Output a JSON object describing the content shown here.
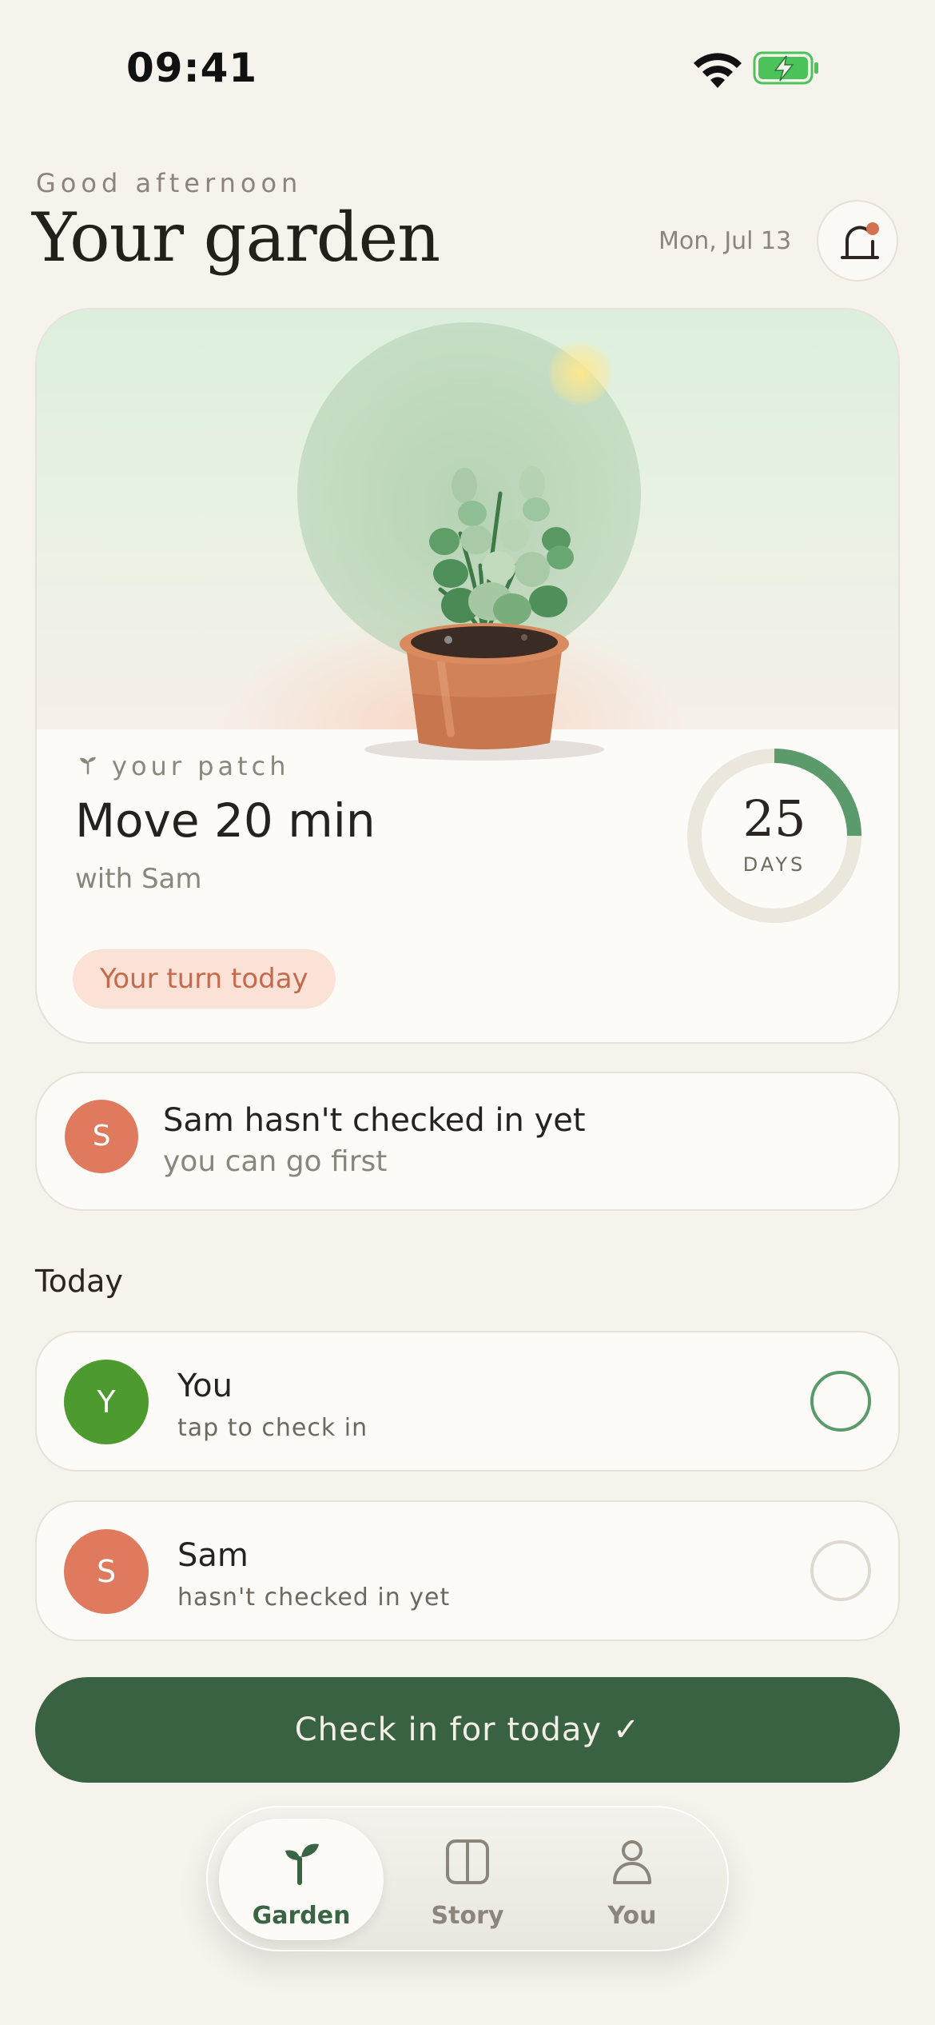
{
  "status_bar": {
    "time": "09:41",
    "wifi_icon": "wifi-icon",
    "battery_icon": "battery-charging-icon"
  },
  "header": {
    "greeting": "Good afternoon",
    "title": "Your garden",
    "date": "Mon, Jul 13",
    "notification_icon": "bell-icon",
    "has_unread": true
  },
  "patch": {
    "label": "your patch",
    "habit": "Move 20 min",
    "partner": "with Sam",
    "turn_badge": "Your turn today",
    "streak_days": "25",
    "streak_unit": "DAYS",
    "streak_progress": 0.25
  },
  "notice": {
    "avatar_initial": "S",
    "title": "Sam hasn't checked in yet",
    "subtitle": "you can go first"
  },
  "today": {
    "heading": "Today",
    "members": [
      {
        "initial": "Y",
        "name": "You",
        "status": "tap to check in",
        "avatar_color": "#4d9a2e",
        "checked": false
      },
      {
        "initial": "S",
        "name": "Sam",
        "status": "hasn't checked in yet",
        "avatar_color": "#e07a5f",
        "checked": false
      }
    ]
  },
  "cta": {
    "label": "Check in for today ✓"
  },
  "tabs": [
    {
      "label": "Garden",
      "icon": "sprout-icon",
      "active": true
    },
    {
      "label": "Story",
      "icon": "book-icon",
      "active": false
    },
    {
      "label": "You",
      "icon": "person-icon",
      "active": false
    }
  ],
  "colors": {
    "background": "#f6f2ec",
    "accent_green": "#386242",
    "streak_green": "#5b9a6a",
    "terracotta": "#e07a5f",
    "badge_bg": "#fbe1d6"
  }
}
